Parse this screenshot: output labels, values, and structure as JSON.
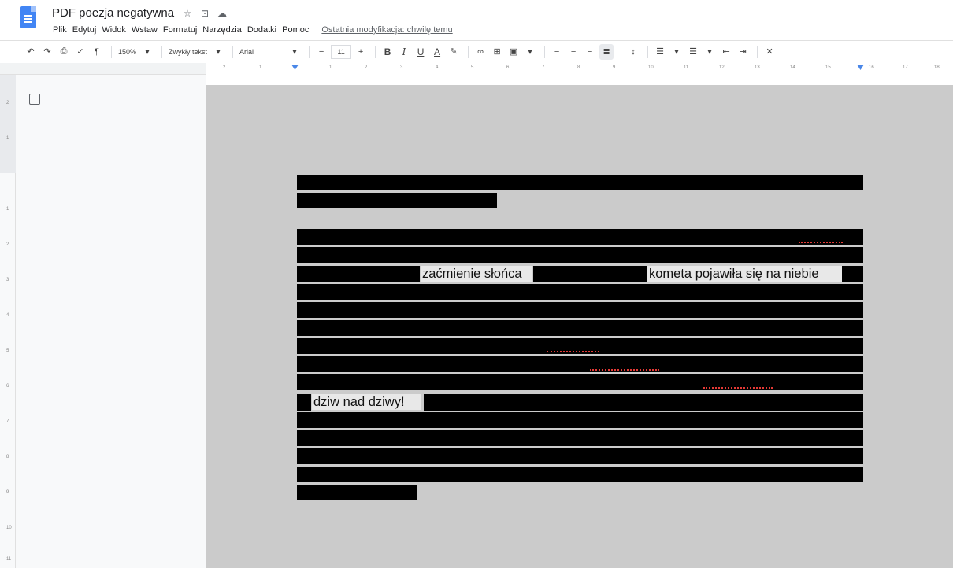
{
  "app": {
    "doc_title": "PDF poezja negatywna",
    "title_icons": [
      "star-icon",
      "move-to-folder-icon",
      "cloud-status-icon"
    ]
  },
  "menu": {
    "items": [
      "Plik",
      "Edytuj",
      "Widok",
      "Wstaw",
      "Formatuj",
      "Narzędzia",
      "Dodatki",
      "Pomoc"
    ],
    "last_edit": "Ostatnia modyfikacja: chwilę temu"
  },
  "toolbar": {
    "zoom": "150%",
    "style": "Zwykły tekst",
    "font": "Arial",
    "font_size": "11",
    "minus": "−",
    "plus": "+",
    "bold": "B",
    "italic": "I",
    "underline": "U",
    "text_color": "A"
  },
  "ruler": {
    "ticks": [
      "2",
      "1",
      "1",
      "2",
      "3",
      "4",
      "5",
      "6",
      "7",
      "8",
      "9",
      "10",
      "11",
      "12",
      "13",
      "14",
      "15",
      "16",
      "17",
      "18"
    ]
  },
  "vruler": {
    "ticks": [
      "2",
      "1",
      "1",
      "2",
      "3",
      "4",
      "5",
      "6",
      "7",
      "8",
      "9",
      "10",
      "11"
    ]
  },
  "document": {
    "visible_phrases": {
      "eclipse": "zaćmienie słońca",
      "comet": "kometa pojawiła się na niebie",
      "wonder": "dziw nad dziwy!"
    }
  },
  "colors": {
    "accent": "#4285f4",
    "redaction": "#000000",
    "page_bg": "#cbcbcb",
    "spellcheck": "#e53935"
  }
}
